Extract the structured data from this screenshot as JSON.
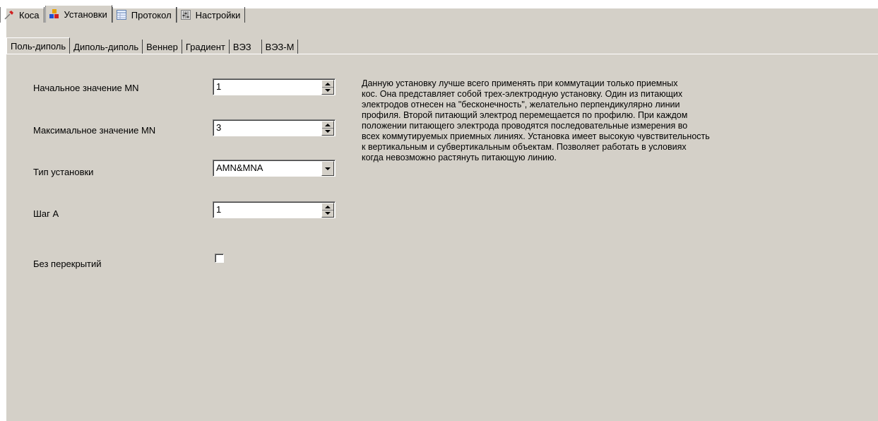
{
  "top_tabs": [
    {
      "label": "Коса",
      "icon": "pin-icon"
    },
    {
      "label": "Установки",
      "icon": "blocks-icon"
    },
    {
      "label": "Протокол",
      "icon": "table-icon"
    },
    {
      "label": "Настройки",
      "icon": "sliders-icon"
    }
  ],
  "active_top_tab": "Установки",
  "sub_tabs": [
    "Поль-диполь",
    "Диполь-диполь",
    "Веннер",
    "Градиент",
    "ВЭЗ",
    "ВЭЗ-М"
  ],
  "active_sub_tab": "Поль-диполь",
  "form": {
    "start_mn_label": "Начальное значение MN",
    "start_mn_value": "1",
    "max_mn_label": "Максимальное значение MN",
    "max_mn_value": "3",
    "type_label": "Тип установки",
    "type_value": "AMN&MNA",
    "step_label": "Шаг A",
    "step_value": "1",
    "no_overlap_label": "Без перекрытий",
    "no_overlap_checked": false
  },
  "description": "Данную установку лучше всего применять при коммутации только приемных\nкос. Она представляет собой трех-электродную установку. Один из питающих\nэлектродов отнесен на \"бесконечность\", желательно перпендикулярно линии\nпрофиля. Второй питающий электрод перемещается по профилю. При каждом\nположении питающего электрода проводятся последовательные измерения во\nвсех коммутируемых приемных линиях. Установка имеет высокую чувствительность\n к вертикальным и субвертикальным объектам. Позволяет работать в условиях\nкогда невозможно растянуть питающую линию."
}
